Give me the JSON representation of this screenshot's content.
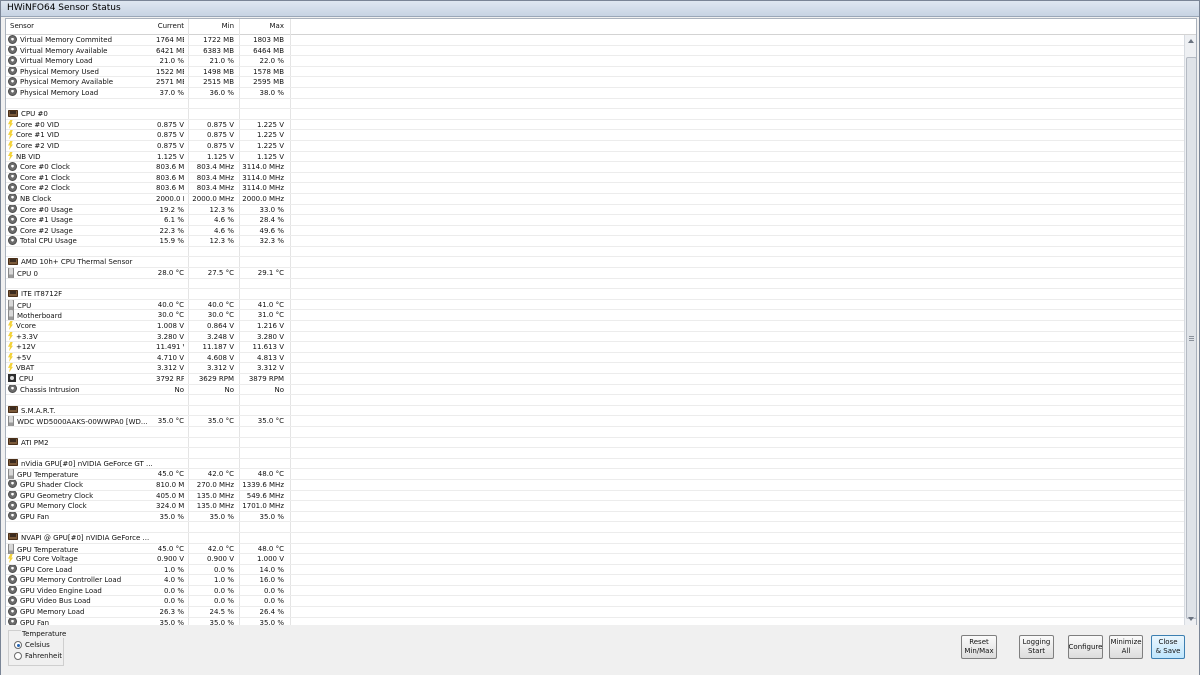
{
  "window": {
    "title": "HWiNFO64 Sensor Status"
  },
  "columns": {
    "sensor": "Sensor",
    "current": "Current",
    "min": "Min",
    "max": "Max"
  },
  "rows": [
    {
      "type": "item",
      "icon": "gauge",
      "name": "Virtual Memory Commited",
      "cur": "1764 MB",
      "min": "1722 MB",
      "max": "1803 MB"
    },
    {
      "type": "item",
      "icon": "gauge",
      "name": "Virtual Memory Available",
      "cur": "6421 MB",
      "min": "6383 MB",
      "max": "6464 MB"
    },
    {
      "type": "item",
      "icon": "gauge",
      "name": "Virtual Memory Load",
      "cur": "21.0 %",
      "min": "21.0 %",
      "max": "22.0 %"
    },
    {
      "type": "item",
      "icon": "gauge",
      "name": "Physical Memory Used",
      "cur": "1522 MB",
      "min": "1498 MB",
      "max": "1578 MB"
    },
    {
      "type": "item",
      "icon": "gauge",
      "name": "Physical Memory Available",
      "cur": "2571 MB",
      "min": "2515 MB",
      "max": "2595 MB"
    },
    {
      "type": "item",
      "icon": "gauge",
      "name": "Physical Memory Load",
      "cur": "37.0 %",
      "min": "36.0 %",
      "max": "38.0 %"
    },
    {
      "type": "blank"
    },
    {
      "type": "group",
      "icon": "chip",
      "name": "CPU #0"
    },
    {
      "type": "item",
      "icon": "volt",
      "name": "Core #0 VID",
      "cur": "0.875 V",
      "min": "0.875 V",
      "max": "1.225 V"
    },
    {
      "type": "item",
      "icon": "volt",
      "name": "Core #1 VID",
      "cur": "0.875 V",
      "min": "0.875 V",
      "max": "1.225 V"
    },
    {
      "type": "item",
      "icon": "volt",
      "name": "Core #2 VID",
      "cur": "0.875 V",
      "min": "0.875 V",
      "max": "1.225 V"
    },
    {
      "type": "item",
      "icon": "volt",
      "name": "NB VID",
      "cur": "1.125 V",
      "min": "1.125 V",
      "max": "1.125 V"
    },
    {
      "type": "item",
      "icon": "gauge",
      "name": "Core #0 Clock",
      "cur": "803.6 MHz",
      "min": "803.4 MHz",
      "max": "3114.0 MHz"
    },
    {
      "type": "item",
      "icon": "gauge",
      "name": "Core #1 Clock",
      "cur": "803.6 MHz",
      "min": "803.4 MHz",
      "max": "3114.0 MHz"
    },
    {
      "type": "item",
      "icon": "gauge",
      "name": "Core #2 Clock",
      "cur": "803.6 MHz",
      "min": "803.4 MHz",
      "max": "3114.0 MHz"
    },
    {
      "type": "item",
      "icon": "gauge",
      "name": "NB Clock",
      "cur": "2000.0 MHz",
      "min": "2000.0 MHz",
      "max": "2000.0 MHz"
    },
    {
      "type": "item",
      "icon": "gauge",
      "name": "Core #0 Usage",
      "cur": "19.2 %",
      "min": "12.3 %",
      "max": "33.0 %"
    },
    {
      "type": "item",
      "icon": "gauge",
      "name": "Core #1 Usage",
      "cur": "6.1 %",
      "min": "4.6 %",
      "max": "28.4 %"
    },
    {
      "type": "item",
      "icon": "gauge",
      "name": "Core #2 Usage",
      "cur": "22.3 %",
      "min": "4.6 %",
      "max": "49.6 %"
    },
    {
      "type": "item",
      "icon": "gauge",
      "name": "Total CPU Usage",
      "cur": "15.9 %",
      "min": "12.3 %",
      "max": "32.3 %"
    },
    {
      "type": "blank"
    },
    {
      "type": "group",
      "icon": "chip",
      "name": "AMD 10h+ CPU Thermal Sensor"
    },
    {
      "type": "item",
      "icon": "temp",
      "name": "CPU 0",
      "cur": "28.0 °C",
      "min": "27.5 °C",
      "max": "29.1 °C"
    },
    {
      "type": "blank"
    },
    {
      "type": "group",
      "icon": "chip",
      "name": "ITE IT8712F"
    },
    {
      "type": "item",
      "icon": "temp",
      "name": "CPU",
      "cur": "40.0 °C",
      "min": "40.0 °C",
      "max": "41.0 °C"
    },
    {
      "type": "item",
      "icon": "temp",
      "name": "Motherboard",
      "cur": "30.0 °C",
      "min": "30.0 °C",
      "max": "31.0 °C"
    },
    {
      "type": "item",
      "icon": "volt",
      "name": "Vcore",
      "cur": "1.008 V",
      "min": "0.864 V",
      "max": "1.216 V"
    },
    {
      "type": "item",
      "icon": "volt",
      "name": "+3.3V",
      "cur": "3.280 V",
      "min": "3.248 V",
      "max": "3.280 V"
    },
    {
      "type": "item",
      "icon": "volt",
      "name": "+12V",
      "cur": "11.491 V",
      "min": "11.187 V",
      "max": "11.613 V"
    },
    {
      "type": "item",
      "icon": "volt",
      "name": "+5V",
      "cur": "4.710 V",
      "min": "4.608 V",
      "max": "4.813 V"
    },
    {
      "type": "item",
      "icon": "volt",
      "name": "VBAT",
      "cur": "3.312 V",
      "min": "3.312 V",
      "max": "3.312 V"
    },
    {
      "type": "item",
      "icon": "fan",
      "name": "CPU",
      "cur": "3792 RPM",
      "min": "3629 RPM",
      "max": "3879 RPM"
    },
    {
      "type": "item",
      "icon": "gauge",
      "name": "Chassis Intrusion",
      "cur": "No",
      "min": "No",
      "max": "No"
    },
    {
      "type": "blank"
    },
    {
      "type": "group",
      "icon": "chip",
      "name": "S.M.A.R.T."
    },
    {
      "type": "item",
      "icon": "temp",
      "name": "WDC WD5000AAKS-00WWPA0 [WD...",
      "cur": "35.0 °C",
      "min": "35.0 °C",
      "max": "35.0 °C"
    },
    {
      "type": "blank"
    },
    {
      "type": "group",
      "icon": "chip",
      "name": "ATI PM2"
    },
    {
      "type": "blank"
    },
    {
      "type": "group",
      "icon": "chip",
      "name": "nVidia GPU[#0] nVIDIA GeForce GT ..."
    },
    {
      "type": "item",
      "icon": "temp",
      "name": "GPU Temperature",
      "cur": "45.0 °C",
      "min": "42.0 °C",
      "max": "48.0 °C"
    },
    {
      "type": "item",
      "icon": "gauge",
      "name": "GPU Shader Clock",
      "cur": "810.0 MHz",
      "min": "270.0 MHz",
      "max": "1339.6 MHz"
    },
    {
      "type": "item",
      "icon": "gauge",
      "name": "GPU Geometry Clock",
      "cur": "405.0 MHz",
      "min": "135.0 MHz",
      "max": "549.6 MHz"
    },
    {
      "type": "item",
      "icon": "gauge",
      "name": "GPU Memory Clock",
      "cur": "324.0 MHz",
      "min": "135.0 MHz",
      "max": "1701.0 MHz"
    },
    {
      "type": "item",
      "icon": "gauge",
      "name": "GPU Fan",
      "cur": "35.0 %",
      "min": "35.0 %",
      "max": "35.0 %"
    },
    {
      "type": "blank"
    },
    {
      "type": "group",
      "icon": "chip",
      "name": "NVAPI @ GPU[#0] nVIDIA GeForce ..."
    },
    {
      "type": "item",
      "icon": "temp",
      "name": "GPU Temperature",
      "cur": "45.0 °C",
      "min": "42.0 °C",
      "max": "48.0 °C"
    },
    {
      "type": "item",
      "icon": "volt",
      "name": "GPU Core Voltage",
      "cur": "0.900 V",
      "min": "0.900 V",
      "max": "1.000 V"
    },
    {
      "type": "item",
      "icon": "gauge",
      "name": "GPU Core Load",
      "cur": "1.0 %",
      "min": "0.0 %",
      "max": "14.0 %"
    },
    {
      "type": "item",
      "icon": "gauge",
      "name": "GPU Memory Controller Load",
      "cur": "4.0 %",
      "min": "1.0 %",
      "max": "16.0 %"
    },
    {
      "type": "item",
      "icon": "gauge",
      "name": "GPU Video Engine Load",
      "cur": "0.0 %",
      "min": "0.0 %",
      "max": "0.0 %"
    },
    {
      "type": "item",
      "icon": "gauge",
      "name": "GPU Video Bus Load",
      "cur": "0.0 %",
      "min": "0.0 %",
      "max": "0.0 %"
    },
    {
      "type": "item",
      "icon": "gauge",
      "name": "GPU Memory Load",
      "cur": "26.3 %",
      "min": "24.5 %",
      "max": "26.4 %"
    },
    {
      "type": "item",
      "icon": "gauge",
      "name": "GPU Fan",
      "cur": "35.0 %",
      "min": "35.0 %",
      "max": "35.0 %"
    }
  ],
  "temperature": {
    "legend": "Temperature",
    "options": [
      {
        "label": "Celsius",
        "selected": true
      },
      {
        "label": "Fahrenheit",
        "selected": false
      }
    ]
  },
  "buttons": {
    "reset": "Reset\nMin/Max",
    "logging": "Logging\nStart",
    "configure": "Configure",
    "minimize": "Minimize\nAll",
    "close": "Close\n& Save"
  }
}
